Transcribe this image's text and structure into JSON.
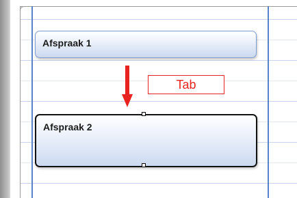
{
  "calendar": {
    "appointments": [
      {
        "label": "Afspraak 1",
        "selected": false
      },
      {
        "label": "Afspraak 2",
        "selected": true
      }
    ]
  },
  "annotation": {
    "key_label": "Tab",
    "arrow_direction": "down"
  },
  "colors": {
    "accent_red": "#e8231f",
    "day_separator": "#5b82c9",
    "gridline": "#c8d3ea",
    "appointment_fill": "#cbd9ef",
    "appointment_border": "#7f9fd2",
    "selection_border": "#111111"
  }
}
